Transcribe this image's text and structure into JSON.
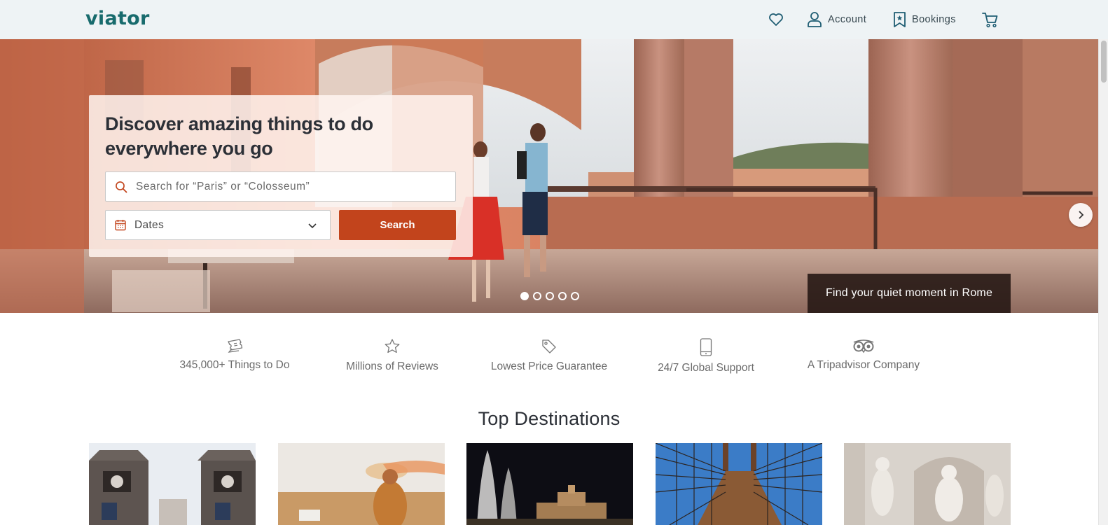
{
  "header": {
    "logo": "viator",
    "account_label": "Account",
    "bookings_label": "Bookings",
    "icons": [
      "heart-icon",
      "user-icon",
      "bookmark-icon",
      "cart-icon"
    ]
  },
  "hero": {
    "headline": "Discover amazing things to do everywhere you go",
    "search_placeholder": "Search for “Paris” or “Colosseum”",
    "dates_value": "Dates",
    "search_button": "Search",
    "caption": "Find your quiet moment in Rome",
    "slide_count": 5,
    "active_slide": 1
  },
  "features": [
    {
      "icon": "ticket-icon",
      "label": "345,000+ Things to Do"
    },
    {
      "icon": "star-icon",
      "label": "Millions of Reviews"
    },
    {
      "icon": "price-tag-icon",
      "label": "Lowest Price Guarantee"
    },
    {
      "icon": "phone-icon",
      "label": "24/7 Global Support"
    },
    {
      "icon": "tripadvisor-owl-icon",
      "label": "A Tripadvisor Company"
    }
  ],
  "destinations": {
    "title": "Top Destinations"
  },
  "colors": {
    "brand": "#186b6d",
    "cta": "#c2441c",
    "header_bg": "#eef3f5",
    "text_dark": "#2c3037"
  }
}
